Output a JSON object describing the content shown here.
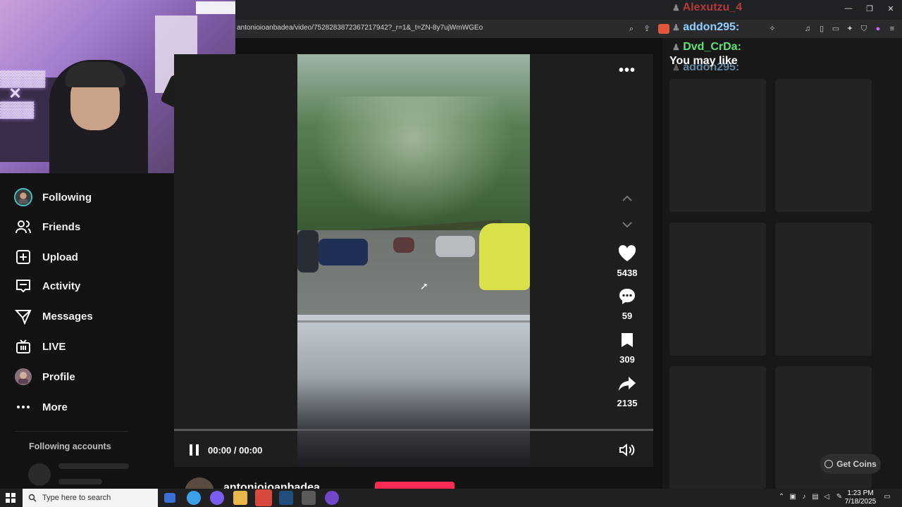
{
  "browser": {
    "url": "antonioioanbadea/video/7528283872367217942?_r=1&_t=ZN-8y7ujWmWGEo",
    "window_controls": [
      "minimize",
      "restore",
      "close"
    ]
  },
  "chat": {
    "lines": [
      {
        "user": "Alexutzu_4",
        "color": "#b33a3a"
      },
      {
        "user": "addon295:",
        "color": "#8fd0ff"
      },
      {
        "user": "Dvd_CrDa:",
        "color": "#5ee27a"
      },
      {
        "user": "addon295:",
        "color": "#8fd0ff"
      }
    ]
  },
  "sidebar": {
    "items": [
      {
        "label": "Following",
        "icon": "following-avatar-icon"
      },
      {
        "label": "Friends",
        "icon": "friends-icon"
      },
      {
        "label": "Upload",
        "icon": "upload-icon"
      },
      {
        "label": "Activity",
        "icon": "activity-icon"
      },
      {
        "label": "Messages",
        "icon": "messages-icon"
      },
      {
        "label": "LIVE",
        "icon": "live-icon"
      },
      {
        "label": "Profile",
        "icon": "profile-avatar-icon"
      },
      {
        "label": "More",
        "icon": "more-icon"
      }
    ],
    "following_accounts_title": "Following accounts"
  },
  "player": {
    "time": "00:00 / 00:00",
    "state": "playing"
  },
  "actions": {
    "likes": "5438",
    "comments": "59",
    "saves": "309",
    "shares": "2135"
  },
  "author": {
    "name": "antonioioanbadea"
  },
  "right_panel": {
    "title": "You may like",
    "get_coins": "Get Coins"
  },
  "taskbar": {
    "search_placeholder": "Type here to search",
    "time": "1:23 PM",
    "date": "7/18/2025"
  }
}
